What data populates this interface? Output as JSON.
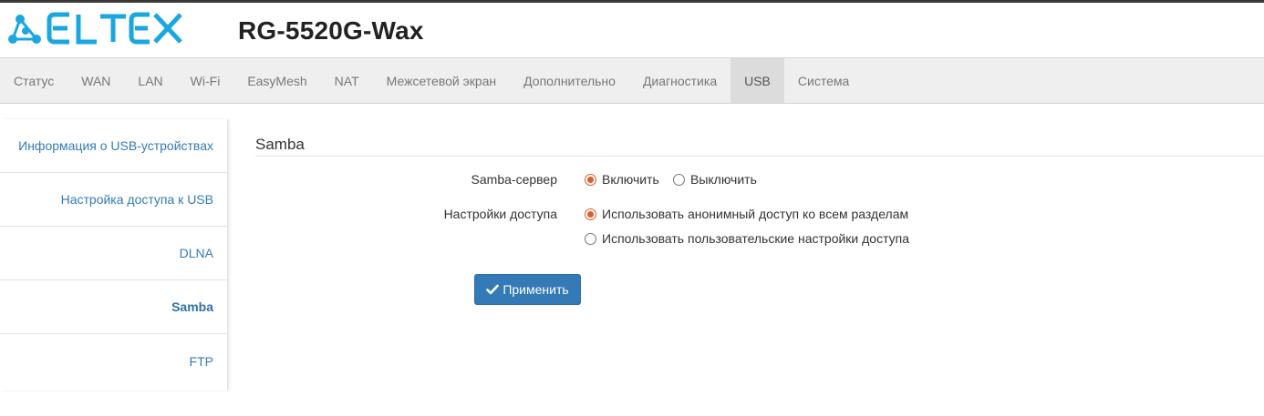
{
  "header": {
    "logo_text": "ELTEX",
    "model": "RG-5520G-Wax",
    "brand_color": "#1aa7e0"
  },
  "nav": {
    "items": [
      {
        "label": "Статус"
      },
      {
        "label": "WAN"
      },
      {
        "label": "LAN"
      },
      {
        "label": "Wi-Fi"
      },
      {
        "label": "EasyMesh"
      },
      {
        "label": "NAT"
      },
      {
        "label": "Межсетевой экран"
      },
      {
        "label": "Дополнительно"
      },
      {
        "label": "Диагностика"
      },
      {
        "label": "USB",
        "active": true
      },
      {
        "label": "Система"
      }
    ]
  },
  "sidebar": {
    "items": [
      {
        "label": "Информация о USB-устройствах"
      },
      {
        "label": "Настройка доступа к USB"
      },
      {
        "label": "DLNA"
      },
      {
        "label": "Samba",
        "active": true
      },
      {
        "label": "FTP"
      }
    ]
  },
  "main": {
    "section_title": "Samba",
    "samba_server": {
      "label": "Samba-сервер",
      "options": [
        "Включить",
        "Выключить"
      ],
      "selected": "Включить"
    },
    "access": {
      "label": "Настройки доступа",
      "options": [
        "Использовать анонимный доступ ко всем разделам",
        "Использовать пользовательские настройки доступа"
      ],
      "selected": "Использовать анонимный доступ ко всем разделам"
    },
    "apply_label": "Применить"
  },
  "colors": {
    "accent_radio": "#e05b2a",
    "button": "#337ab7",
    "link": "#337ab7"
  }
}
